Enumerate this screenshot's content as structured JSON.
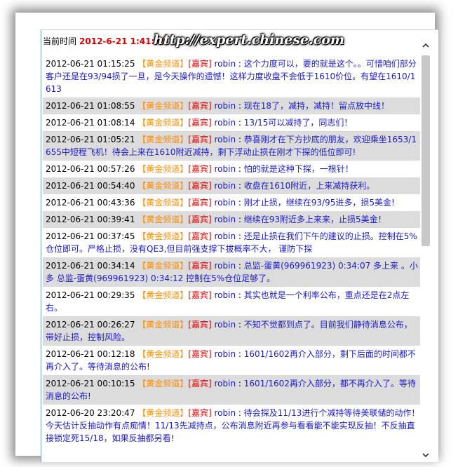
{
  "header": {
    "label": "当前时间",
    "time": "2012-6-21 1:41:39",
    "watermark": "http://expert.chinese.com"
  },
  "messages": [
    {
      "time": "2012-06-21 01:15:25",
      "channel": "【黄金频道】",
      "role": "[嘉宾]",
      "user": "robin",
      "text": "这个力度可以，要的就是这个。。可惜咱们部分客户还是在93/94损了一旦，是今天操作的遗憾！这样力度收盘不会低于1610价位。有望在1610/1613"
    },
    {
      "time": "2012-06-21 01:08:55",
      "channel": "【黄金频道】",
      "role": "[嘉宾]",
      "user": "robin",
      "text": "现在18了，减持，减持！留点放中线！"
    },
    {
      "time": "2012-06-21 01:08:14",
      "channel": "【黄金频道】",
      "role": "[嘉宾]",
      "user": "robin",
      "text": "13/15可以减持了，同志们！"
    },
    {
      "time": "2012-06-21 01:05:21",
      "channel": "【黄金频道】",
      "role": "[嘉宾]",
      "user": "robin",
      "text": "恭喜刚才在下方抄底的朋友，欢迎乘坐1653/1655中短程飞机！待会上来在1610附近减持，剩下浮动止损在刚才下探的低位即可!"
    },
    {
      "time": "2012-06-21 00:57:26",
      "channel": "【黄金频道】",
      "role": "[嘉宾]",
      "user": "robin",
      "text": "怕的就是这种下探，一根针！"
    },
    {
      "time": "2012-06-21 00:54:40",
      "channel": "【黄金频道】",
      "role": "[嘉宾]",
      "user": "robin",
      "text": "收盘在1610附近，上来减持获利。"
    },
    {
      "time": "2012-06-21 00:43:36",
      "channel": "【黄金频道】",
      "role": "[嘉宾]",
      "user": "robin",
      "text": "刚才止损，继续在93/95进多，损5美金!"
    },
    {
      "time": "2012-06-21 00:39:41",
      "channel": "【黄金频道】",
      "role": "[嘉宾]",
      "user": "robin",
      "text": "继续在93附近多上来来，止损5美金！"
    },
    {
      "time": "2012-06-21 00:37:45",
      "channel": "【黄金频道】",
      "role": "[嘉宾]",
      "user": "robin",
      "text": "还是止损在我们下午的建议的止损。控制在5%仓位即可。严格止损，没有QE3,但目前强支撑下拔概率不大，  谨防下探"
    },
    {
      "time": "2012-06-21 00:34:14",
      "channel": "【黄金频道】",
      "role": "[嘉宾]",
      "user": "robin",
      "text": "总监-蛋黄(969961923) 0:34:07 多上来 。小多 总监-蛋黄(969961923) 0:34:12 控制在5%仓位足够了。"
    },
    {
      "time": "2012-06-21 00:29:35",
      "channel": "【黄金频道】",
      "role": "[嘉宾]",
      "user": "robin",
      "text": "其实也就是一个利率公布，重点还是在2点左右。"
    },
    {
      "time": "2012-06-21 00:26:27",
      "channel": "【黄金频道】",
      "role": "[嘉宾]",
      "user": "robin",
      "text": "不知不觉都到点了。目前我们静待消息公布，带好止损，控制风险。"
    },
    {
      "time": "2012-06-21 00:12:18",
      "channel": "【黄金频道】",
      "role": "[嘉宾]",
      "user": "robin",
      "text": "1601/1602再介入部分，剩下后面的时间都不再介入了。等待消息的公布!"
    },
    {
      "time": "2012-06-21 00:10:15",
      "channel": "【黄金频道】",
      "role": "[嘉宾]",
      "user": "robin",
      "text": "1601/1602再介入部分，都不再介入了。等待消息的公布!"
    },
    {
      "time": "2012-06-20 23:20:47",
      "channel": "【黄金频道】",
      "role": "[嘉宾]",
      "user": "robin",
      "text": "待会探及11/13进行个减持等待美联储的动作！今天估计反抽动作有点痴情！11/13先减持点，公布消息附近再参与看看能不能实现反抽！不反抽直接锁定死15/18，如果反抽都另看!"
    }
  ],
  "scrollbar": {
    "up_icon": "▲",
    "down_icon": "▼"
  }
}
